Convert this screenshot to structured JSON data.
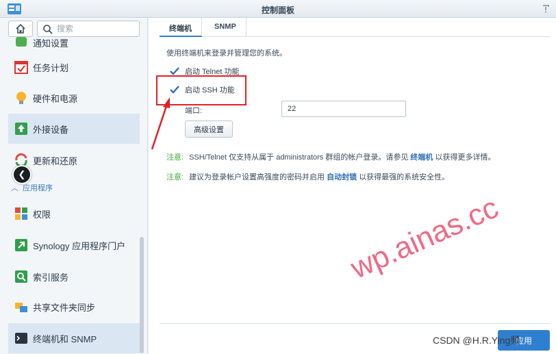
{
  "window": {
    "title": "控制面板"
  },
  "sidebar": {
    "search_placeholder": "搜索",
    "items": [
      {
        "label": "通知设置"
      },
      {
        "label": "任务计划"
      },
      {
        "label": "硬件和电源"
      },
      {
        "label": "外接设备"
      },
      {
        "label": "更新和还原"
      }
    ],
    "section_label": "应用程序",
    "app_items": [
      {
        "label": "权限"
      },
      {
        "label": "Synology 应用程序门户"
      },
      {
        "label": "索引服务"
      },
      {
        "label": "共享文件夹同步"
      },
      {
        "label": "终端机和 SNMP"
      }
    ]
  },
  "tabs": [
    {
      "label": "终端机"
    },
    {
      "label": "SNMP"
    }
  ],
  "terminal": {
    "description": "使用终端机来登录并管理您的系统。",
    "telnet_label": "启动 Telnet 功能",
    "telnet_checked": true,
    "ssh_label": "启动 SSH 功能",
    "ssh_checked": true,
    "port_label": "端口:",
    "port_value": "22",
    "advanced_button": "高级设置",
    "note1_label": "注意:",
    "note1_text_a": "SSH/Telnet 仅支持从属于 administrators 群组的帐户登录。请参见",
    "note1_link": "终端机",
    "note1_text_b": "以获得更多详情。",
    "note2_label": "注意:",
    "note2_text_a": "建议为登录帐户设置高强度的密码并启用",
    "note2_link": "自动封锁",
    "note2_text_b": "以获得最强的系统安全性。",
    "apply_button": "应用"
  },
  "overlay": {
    "watermark": "wp.ainas.cc",
    "csdn_credit": "CSDN @H.R.Ying频"
  },
  "colors": {
    "accent": "#2f7fd0",
    "note_green": "#3cae3a",
    "annotation_red": "#e02027",
    "watermark": "#ee6b87"
  }
}
